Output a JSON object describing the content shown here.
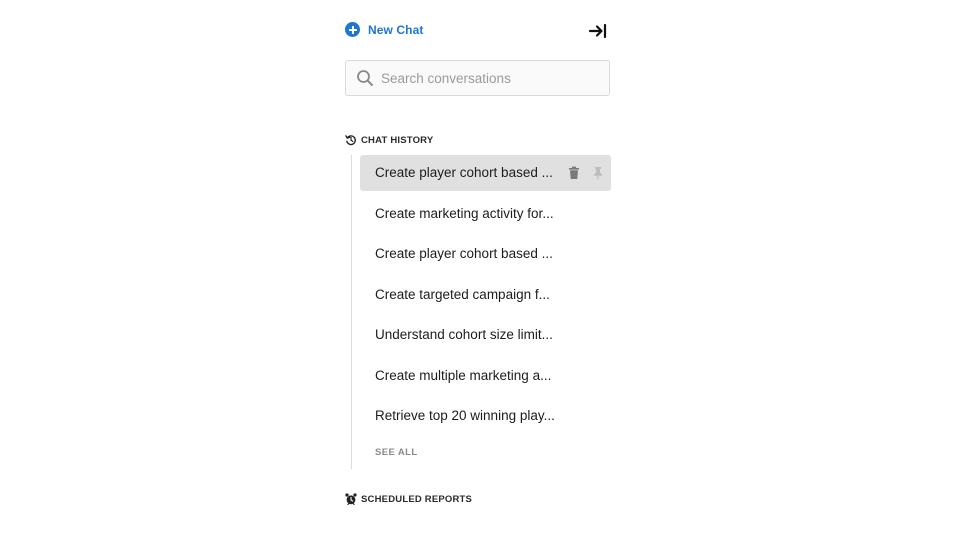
{
  "sidebar": {
    "new_chat_label": "New Chat",
    "search": {
      "placeholder": "Search conversations",
      "value": ""
    },
    "chat_history": {
      "title": "CHAT HISTORY",
      "items": [
        {
          "label": "Create player cohort based ...",
          "active": true
        },
        {
          "label": "Create marketing activity for..."
        },
        {
          "label": "Create player cohort based ..."
        },
        {
          "label": "Create targeted campaign f..."
        },
        {
          "label": "Understand cohort size limit..."
        },
        {
          "label": "Create multiple marketing a..."
        },
        {
          "label": "Retrieve top 20 winning play..."
        }
      ],
      "see_all_label": "SEE ALL"
    },
    "scheduled_reports": {
      "title": "SCHEDULED REPORTS"
    }
  },
  "icons": {
    "new_chat": "plus-circle-icon",
    "collapse": "arrow-right-to-bar-icon",
    "search": "search-icon",
    "history": "history-icon",
    "delete": "trash-icon",
    "pin": "pin-icon",
    "reports": "alarm-clock-icon"
  },
  "colors": {
    "accent": "#1d76d2",
    "active_row": "#e0e0e0",
    "muted_text": "#8a8a8a"
  }
}
